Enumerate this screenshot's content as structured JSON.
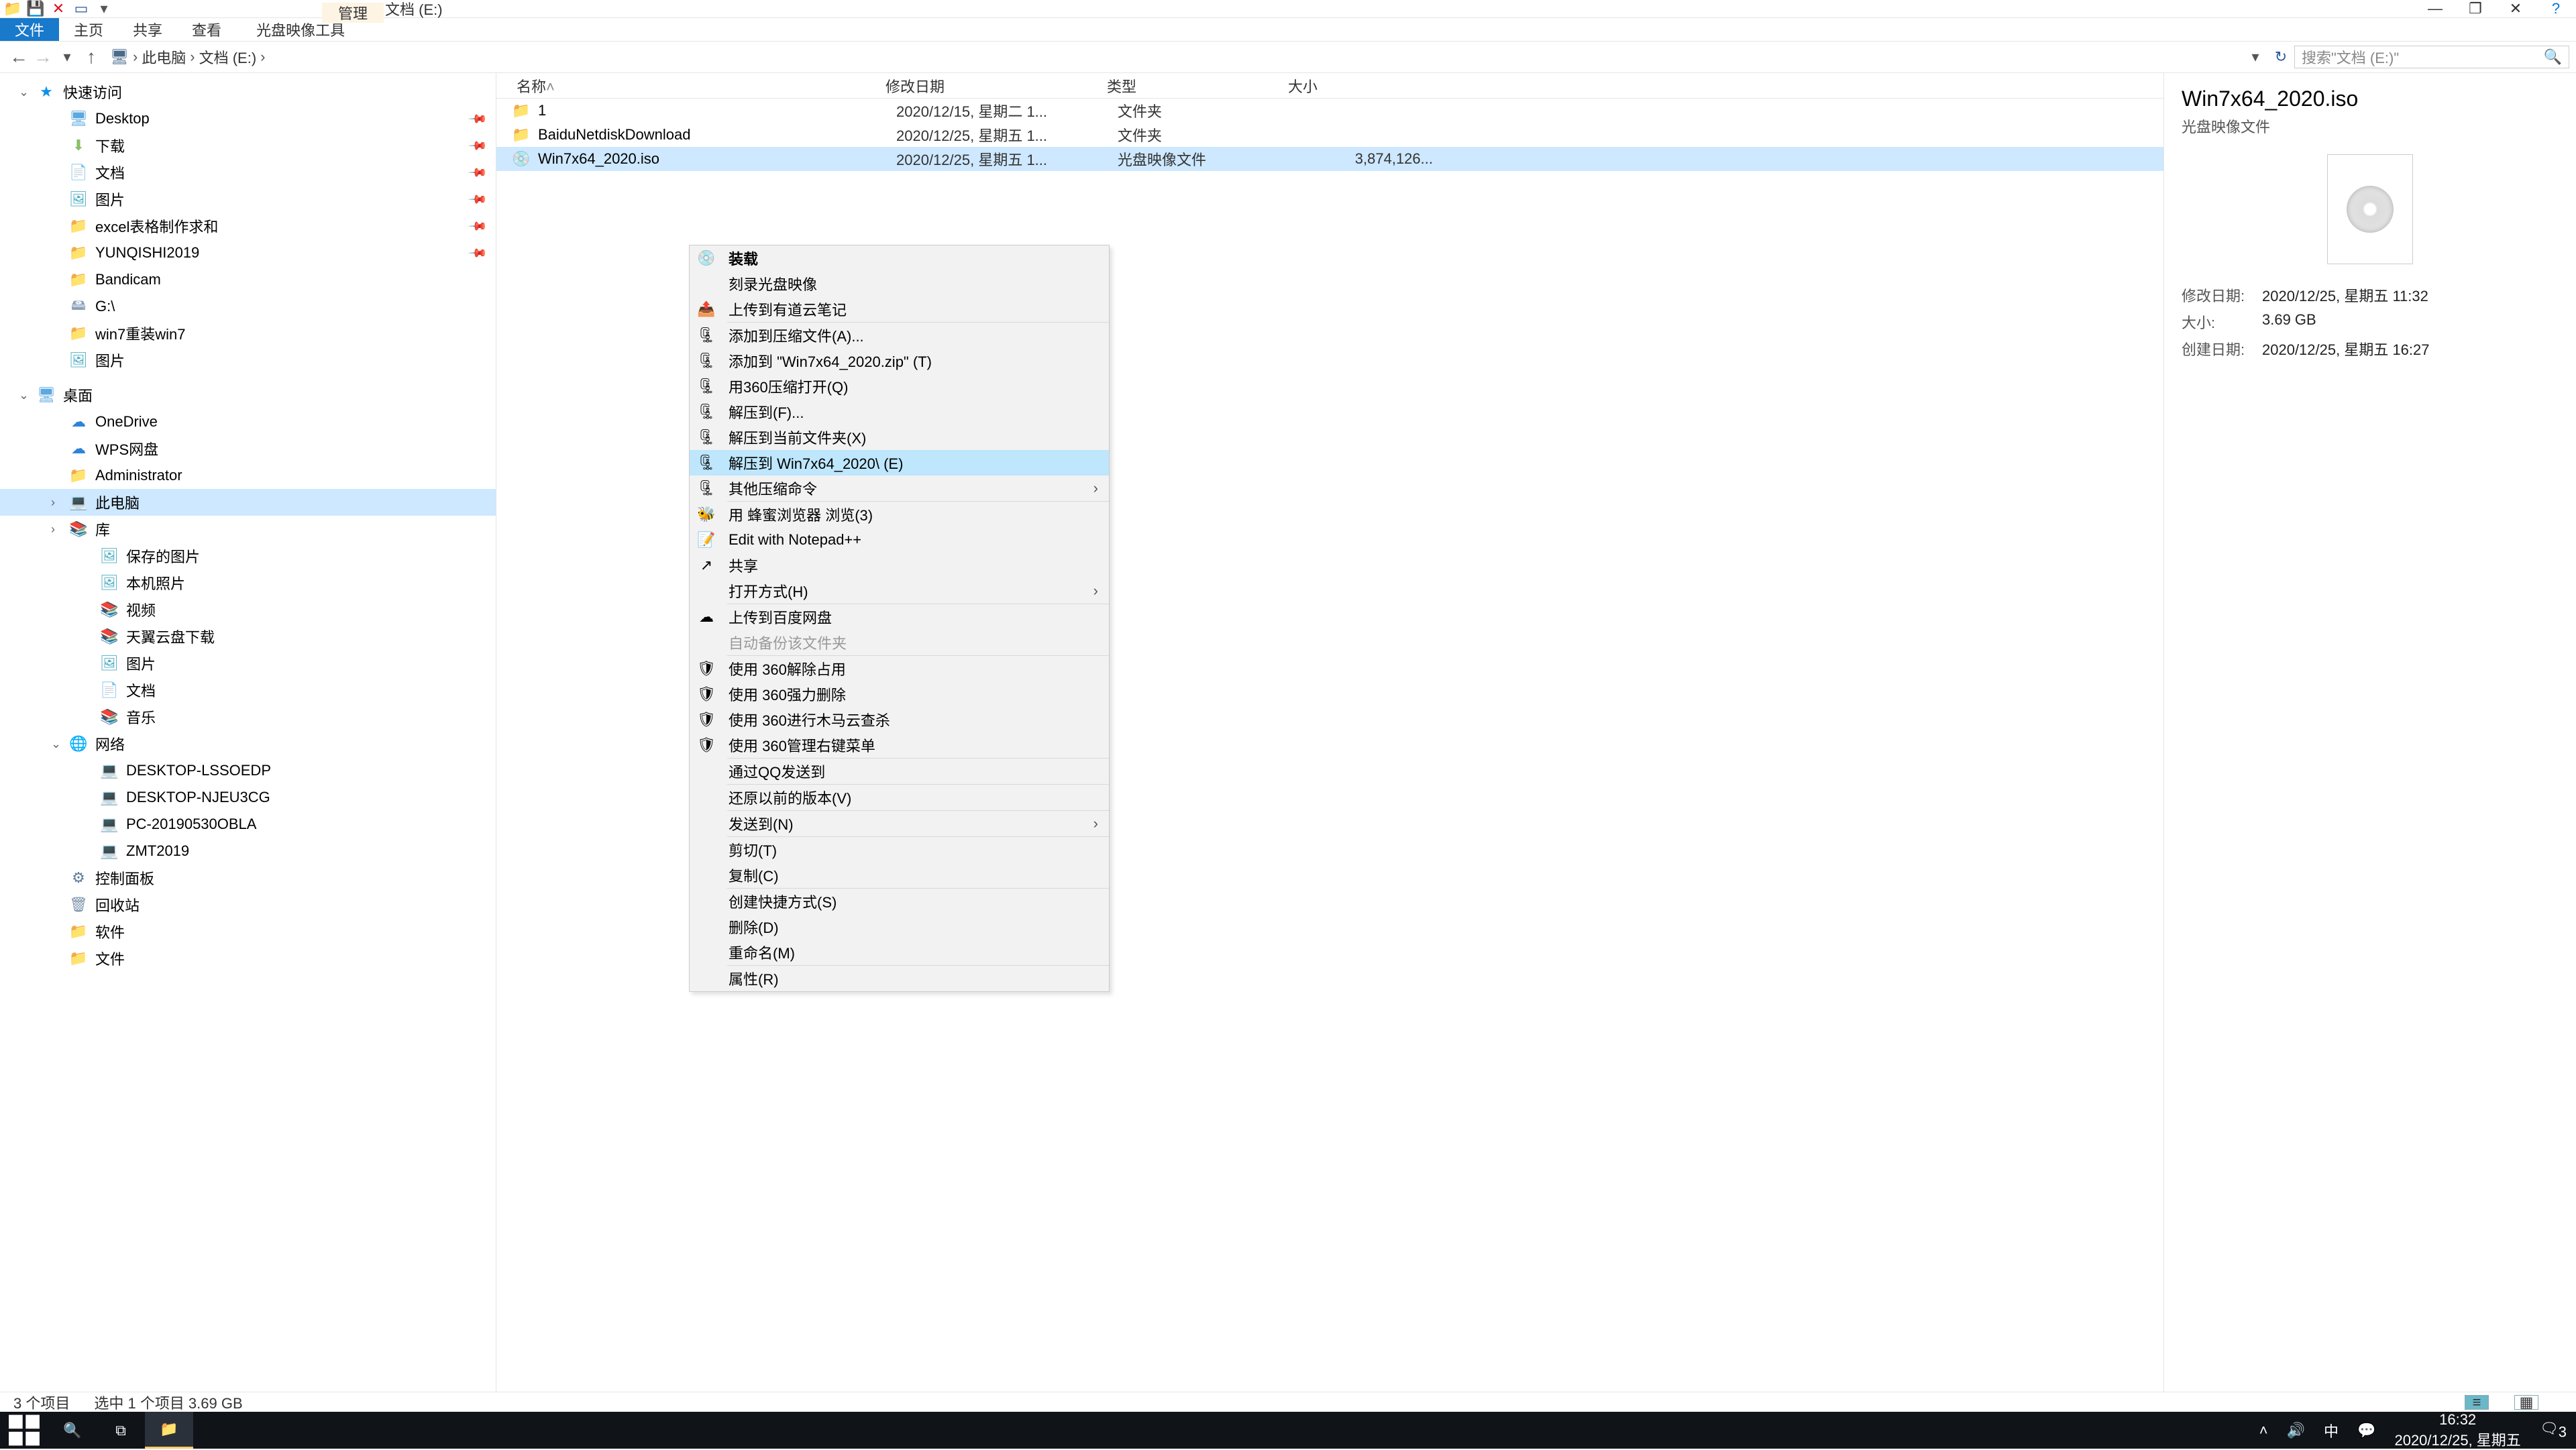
{
  "window": {
    "title_tab_manage": "管理",
    "title_location": "文档 (E:)"
  },
  "ribbon": {
    "file": "文件",
    "home": "主页",
    "share": "共享",
    "view": "查看",
    "iso_tool": "光盘映像工具"
  },
  "breadcrumbs": {
    "pc": "此电脑",
    "drive": "文档 (E:)"
  },
  "search": {
    "placeholder": "搜索\"文档 (E:)\""
  },
  "sidebar": {
    "quick": {
      "label": "快速访问",
      "items": [
        {
          "label": "Desktop",
          "pinned": true,
          "ico": "ico-desktop"
        },
        {
          "label": "下载",
          "pinned": true,
          "ico": "ico-dl"
        },
        {
          "label": "文档",
          "pinned": true,
          "ico": "ico-doc"
        },
        {
          "label": "图片",
          "pinned": true,
          "ico": "ico-pic"
        },
        {
          "label": "excel表格制作求和",
          "pinned": true,
          "ico": "ico-folder"
        },
        {
          "label": "YUNQISHI2019",
          "pinned": true,
          "ico": "ico-folder"
        },
        {
          "label": "Bandicam",
          "ico": "ico-folder"
        },
        {
          "label": "G:\\",
          "ico": "ico-disk"
        },
        {
          "label": "win7重装win7",
          "ico": "ico-folder"
        },
        {
          "label": "图片",
          "ico": "ico-pic"
        }
      ]
    },
    "desktop": {
      "label": "桌面",
      "items": [
        {
          "label": "OneDrive",
          "ico": "ico-cloud"
        },
        {
          "label": "WPS网盘",
          "ico": "ico-cloud"
        },
        {
          "label": "Administrator",
          "ico": "ico-folder"
        },
        {
          "label": "此电脑",
          "ico": "ico-pc",
          "selected": true,
          "caret": ">"
        },
        {
          "label": "库",
          "ico": "ico-lib",
          "caret": ">",
          "children": [
            {
              "label": "保存的图片",
              "ico": "ico-pic"
            },
            {
              "label": "本机照片",
              "ico": "ico-pic"
            },
            {
              "label": "视频",
              "ico": "ico-lib"
            },
            {
              "label": "天翼云盘下载",
              "ico": "ico-lib"
            },
            {
              "label": "图片",
              "ico": "ico-pic"
            },
            {
              "label": "文档",
              "ico": "ico-doc"
            },
            {
              "label": "音乐",
              "ico": "ico-lib"
            }
          ]
        },
        {
          "label": "网络",
          "ico": "ico-net",
          "caret": "v",
          "children": [
            {
              "label": "DESKTOP-LSSOEDP",
              "ico": "ico-pc"
            },
            {
              "label": "DESKTOP-NJEU3CG",
              "ico": "ico-pc"
            },
            {
              "label": "PC-20190530OBLA",
              "ico": "ico-pc"
            },
            {
              "label": "ZMT2019",
              "ico": "ico-pc"
            }
          ]
        },
        {
          "label": "控制面板",
          "ico": "ico-cp"
        },
        {
          "label": "回收站",
          "ico": "ico-bin"
        },
        {
          "label": "软件",
          "ico": "ico-folder"
        },
        {
          "label": "文件",
          "ico": "ico-folder"
        }
      ]
    }
  },
  "columns": {
    "name": "名称",
    "date": "修改日期",
    "type": "类型",
    "size": "大小"
  },
  "files": [
    {
      "name": "1",
      "date": "2020/12/15, 星期二 1...",
      "type": "文件夹",
      "size": "",
      "ico": "ico-folder"
    },
    {
      "name": "BaiduNetdiskDownload",
      "date": "2020/12/25, 星期五 1...",
      "type": "文件夹",
      "size": "",
      "ico": "ico-folder"
    },
    {
      "name": "Win7x64_2020.iso",
      "date": "2020/12/25, 星期五 1...",
      "type": "光盘映像文件",
      "size": "3,874,126...",
      "ico": "ico-disc",
      "selected": true
    }
  ],
  "context": {
    "mount": "装载",
    "burn": "刻录光盘映像",
    "youdao": "上传到有道云笔记",
    "add_archive": "添加到压缩文件(A)...",
    "add_zip": "添加到 \"Win7x64_2020.zip\" (T)",
    "open_360": "用360压缩打开(Q)",
    "extract_to": "解压到(F)...",
    "extract_here": "解压到当前文件夹(X)",
    "extract_named": "解压到 Win7x64_2020\\ (E)",
    "other_compress": "其他压缩命令",
    "bee": "用 蜂蜜浏览器 浏览(3)",
    "npp": "Edit with Notepad++",
    "share": "共享",
    "open_with": "打开方式(H)",
    "baidu": "上传到百度网盘",
    "auto_backup": "自动备份该文件夹",
    "use360_unlock": "使用 360解除占用",
    "use360_force": "使用 360强力删除",
    "use360_trojan": "使用 360进行木马云查杀",
    "use360_menu": "使用 360管理右键菜单",
    "qq": "通过QQ发送到",
    "restore": "还原以前的版本(V)",
    "sendto": "发送到(N)",
    "cut": "剪切(T)",
    "copy": "复制(C)",
    "shortcut": "创建快捷方式(S)",
    "delete": "删除(D)",
    "rename": "重命名(M)",
    "properties": "属性(R)"
  },
  "details": {
    "title": "Win7x64_2020.iso",
    "type": "光盘映像文件",
    "labels": {
      "modified": "修改日期:",
      "size": "大小:",
      "created": "创建日期:"
    },
    "modified": "2020/12/25, 星期五 11:32",
    "size": "3.69 GB",
    "created": "2020/12/25, 星期五 16:27"
  },
  "status": {
    "count": "3 个项目",
    "sel": "选中 1 个项目  3.69 GB"
  },
  "taskbar": {
    "time": "16:32",
    "date": "2020/12/25, 星期五",
    "ime": "中",
    "badge": "3"
  },
  "colors": {
    "sel_bg": "#cde8ff",
    "accent": "#1979ca"
  }
}
